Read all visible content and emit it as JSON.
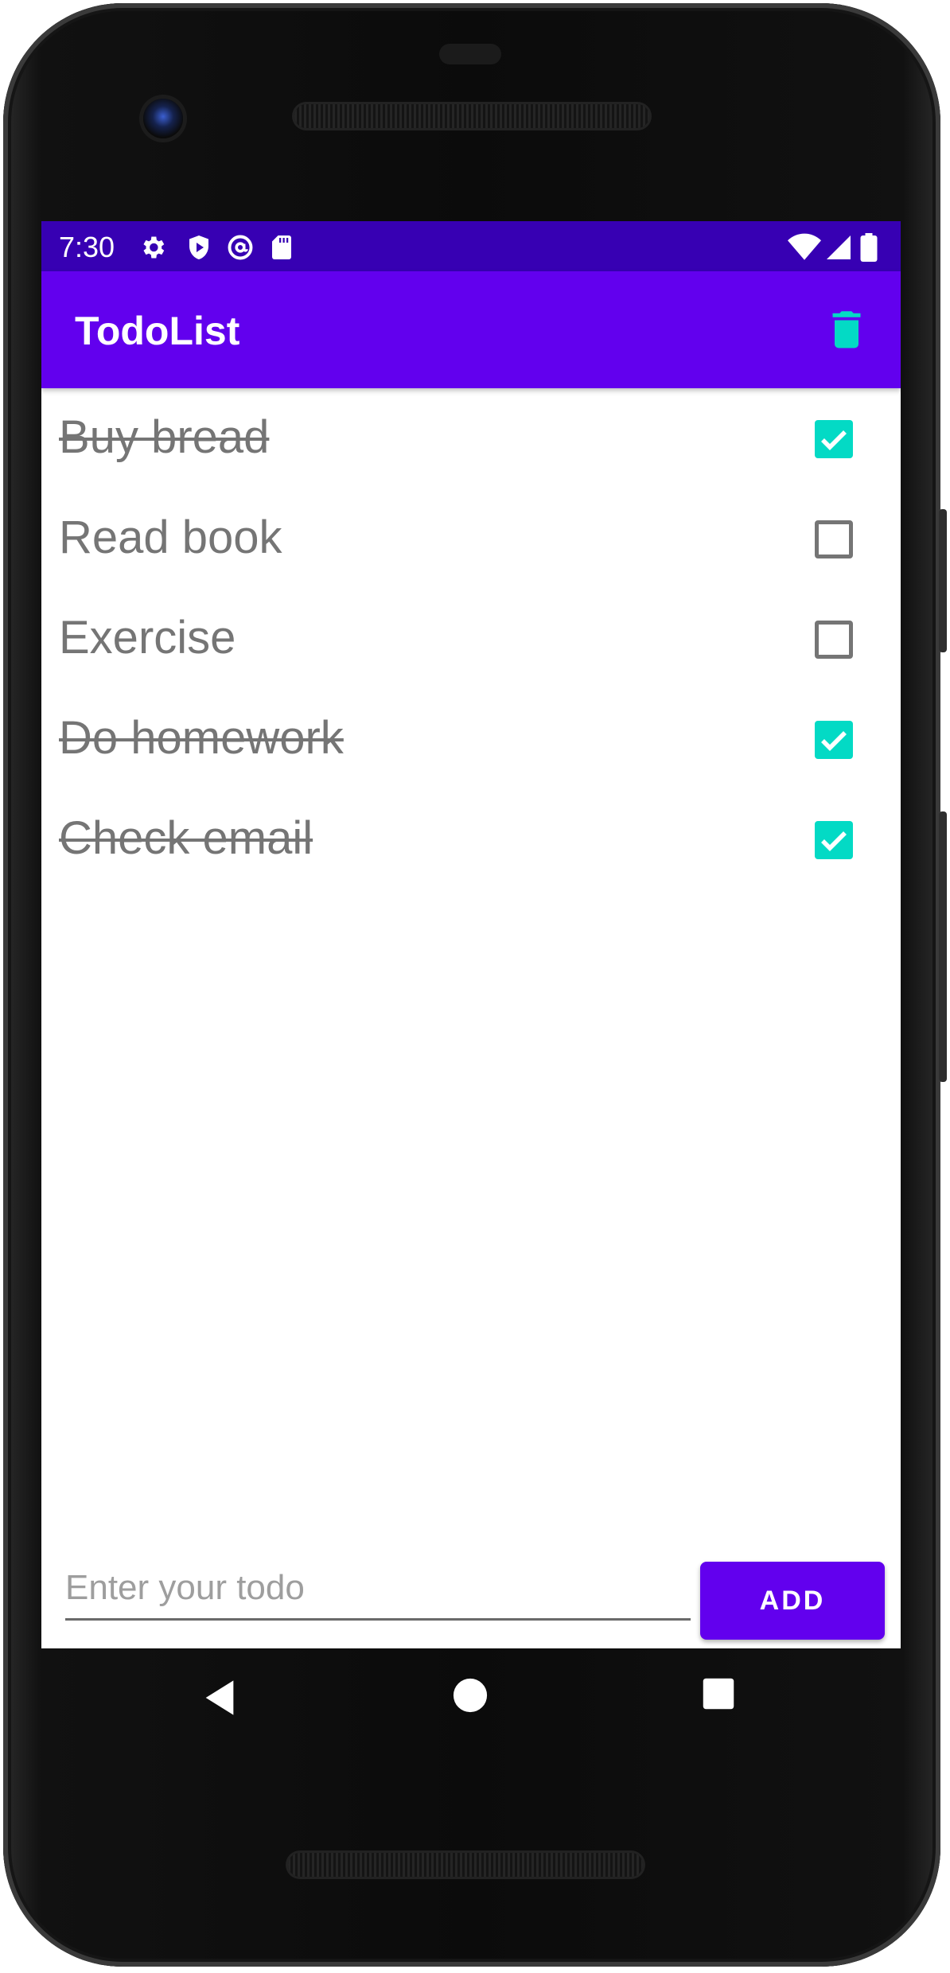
{
  "status_bar": {
    "time": "7:30",
    "left_icons": [
      "settings-icon",
      "shield-icon",
      "at-sign-icon",
      "sd-card-icon"
    ],
    "right_icons": [
      "wifi-icon",
      "signal-icon",
      "battery-icon"
    ]
  },
  "app_bar": {
    "title": "TodoList",
    "delete_icon": "trash-icon",
    "accent_color": "#03dac5",
    "bar_color": "#6200ee",
    "status_color": "#3700b3"
  },
  "todos": [
    {
      "text": "Buy bread",
      "done": true
    },
    {
      "text": "Read book",
      "done": false
    },
    {
      "text": "Exercise",
      "done": false
    },
    {
      "text": "Do homework",
      "done": true
    },
    {
      "text": "Check email",
      "done": true
    }
  ],
  "input": {
    "placeholder": "Enter your todo",
    "value": ""
  },
  "add_button": {
    "label": "ADD"
  },
  "nav_bar": {
    "icons": [
      "back-icon",
      "home-icon",
      "recents-icon"
    ]
  }
}
